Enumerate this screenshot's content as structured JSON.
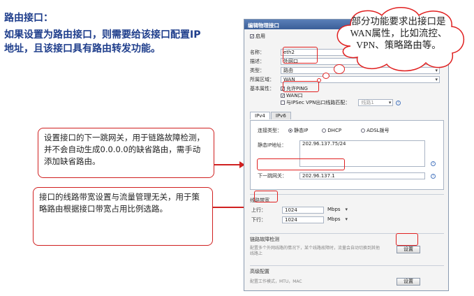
{
  "slide": {
    "title": "路由接口：",
    "body": "如果设置为路由接口，则需要给该接口配置IP地址，且该接口具有路由转发功能。",
    "callout1": "设置接口的下一跳网关，用于链路故障检测，并不会自动生成0.0.0.0的缺省路由，需手动添加缺省路由。",
    "callout2": "接口的线路带宽设置与流量管理无关，用于策略路由根据接口带宽占用比例选路。",
    "cloud": "部分功能要求出接口是WAN属性，比如流控、VPN、策略路由等。"
  },
  "dialog": {
    "title": "编辑物理接口",
    "close": "×",
    "enable_label": "启用",
    "name_label": "名称：",
    "name_value": "eth2",
    "desc_label": "描述：",
    "desc_value": "外网口",
    "type_label": "类型：",
    "type_value": "路由",
    "zone_label": "所属区域：",
    "zone_value": "WAN",
    "attr_label": "基本属性：",
    "allow_ping": "允许PING",
    "wan_port": "WAN口",
    "ipsec": "与IPSec VPN出口线路匹配：",
    "ipsec_sel": "线路1",
    "tab_ipv4": "IPv4",
    "tab_ipv6": "IPv6",
    "conn_type_label": "连接类型：",
    "static_ip": "静态IP",
    "dhcp": "DHCP",
    "adsl": "ADSL拨号",
    "static_ip_label": "静态IP地址：",
    "static_ip_value": "202.96.137.75/24",
    "gateway_label": "下一跳网关：",
    "gateway_value": "202.96.137.1",
    "bandwidth_title": "线路带宽",
    "up_label": "上行：",
    "up_value": "1024",
    "up_unit": "Mbps",
    "down_label": "下行：",
    "down_value": "1024",
    "down_unit": "Mbps",
    "fault_title": "链路故障检测",
    "fault_desc": "配置多个外网线路的情况下，某个线路故障时，流量会自动切换到其他线路上",
    "fault_btn": "设置",
    "adv_title": "高级配置",
    "adv_desc": "配置工作模式，MTU，MAC",
    "adv_btn": "设置"
  }
}
